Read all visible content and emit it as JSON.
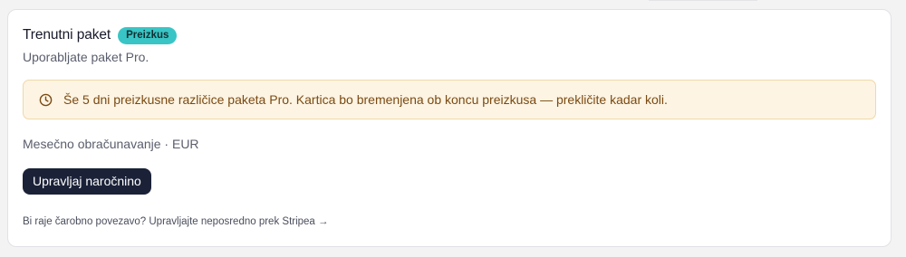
{
  "plan": {
    "title": "Trenutni paket",
    "badge": "Preizkus",
    "subtitle": "Uporabljate paket Pro."
  },
  "alert": {
    "icon": "clock-icon",
    "text": "Še 5 dni preizkusne različice paketa Pro. Kartica bo bremenjena ob koncu preizkusa — prekličite kadar koli."
  },
  "billing": {
    "text": "Mesečno obračunavanje · EUR"
  },
  "actions": {
    "manage_label": "Upravljaj naročnino",
    "stripe_link": "Bi raje čarobno povezavo? Upravljajte neposredno prek Stripea →"
  },
  "colors": {
    "badge": "#39c5c5",
    "button": "#1b2238",
    "alert_bg": "#fdf4e3",
    "alert_border": "#f0d9a8",
    "alert_text": "#7a4a12"
  }
}
